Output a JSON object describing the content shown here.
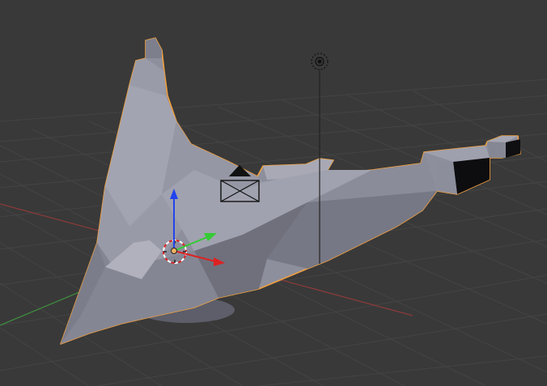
{
  "viewport": {
    "background": "#393939",
    "grid_color": "#454545",
    "x_axis_color": "#8a3a3a",
    "y_axis_color": "#3a8a3a"
  },
  "mesh": {
    "selected_outline_color": "#f0a040",
    "shade_light": "#9b9caa",
    "shade_mid": "#878896",
    "shade_dark": "#6c6d7a"
  },
  "gizmo": {
    "x_color": "#dd2222",
    "y_color": "#33cc33",
    "z_color": "#2244ee",
    "center_color": "#f0b060"
  },
  "icons": {
    "lamp": "lamp-icon",
    "camera": "camera-icon",
    "cursor": "3d-cursor-icon",
    "manipulator": "transform-manipulator-icon"
  }
}
